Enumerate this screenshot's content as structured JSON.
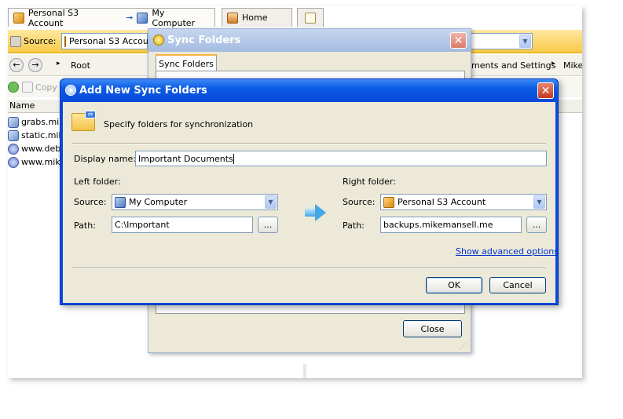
{
  "background_app": {
    "tabs": [
      {
        "label": "Personal S3 Account",
        "icon": "box-icon"
      },
      {
        "label": "My Computer",
        "icon": "computer-icon"
      },
      {
        "label": "Home",
        "icon": "home-icon"
      },
      {
        "label": "",
        "icon": "new-tab-icon"
      }
    ],
    "source_label": "Source:",
    "source_value": "Personal S3 Accoun",
    "breadcrumb": [
      "Root",
      "ments and Settings",
      "Mike"
    ],
    "toolbar_copy": "Copy",
    "list_header": "Name",
    "list_items": [
      "grabs.mike",
      "static.mike",
      "www.debb",
      "www.miker"
    ]
  },
  "sync_window": {
    "title": "Sync Folders",
    "tab": "Sync Folders",
    "close_label": "Close"
  },
  "dialog": {
    "title": "Add New Sync Folders",
    "header_text": "Specify folders for synchronization",
    "display_name_label": "Display name:",
    "display_name_value": "Important Documents",
    "left": {
      "heading": "Left folder:",
      "source_label": "Source:",
      "source_value": "My Computer",
      "path_label": "Path:",
      "path_value": "C:\\Important",
      "browse": "..."
    },
    "right": {
      "heading": "Right folder:",
      "source_label": "Source:",
      "source_value": "Personal S3 Account",
      "path_label": "Path:",
      "path_value": "backups.mikemansell.me",
      "browse": "..."
    },
    "advanced_link": "Show advanced options",
    "ok": "OK",
    "cancel": "Cancel"
  },
  "colors": {
    "xp_title_blue": "#0a4ad9",
    "dialog_face": "#ece9d8",
    "close_red": "#e0523a",
    "source_bar_yellow": "#f7c948"
  }
}
